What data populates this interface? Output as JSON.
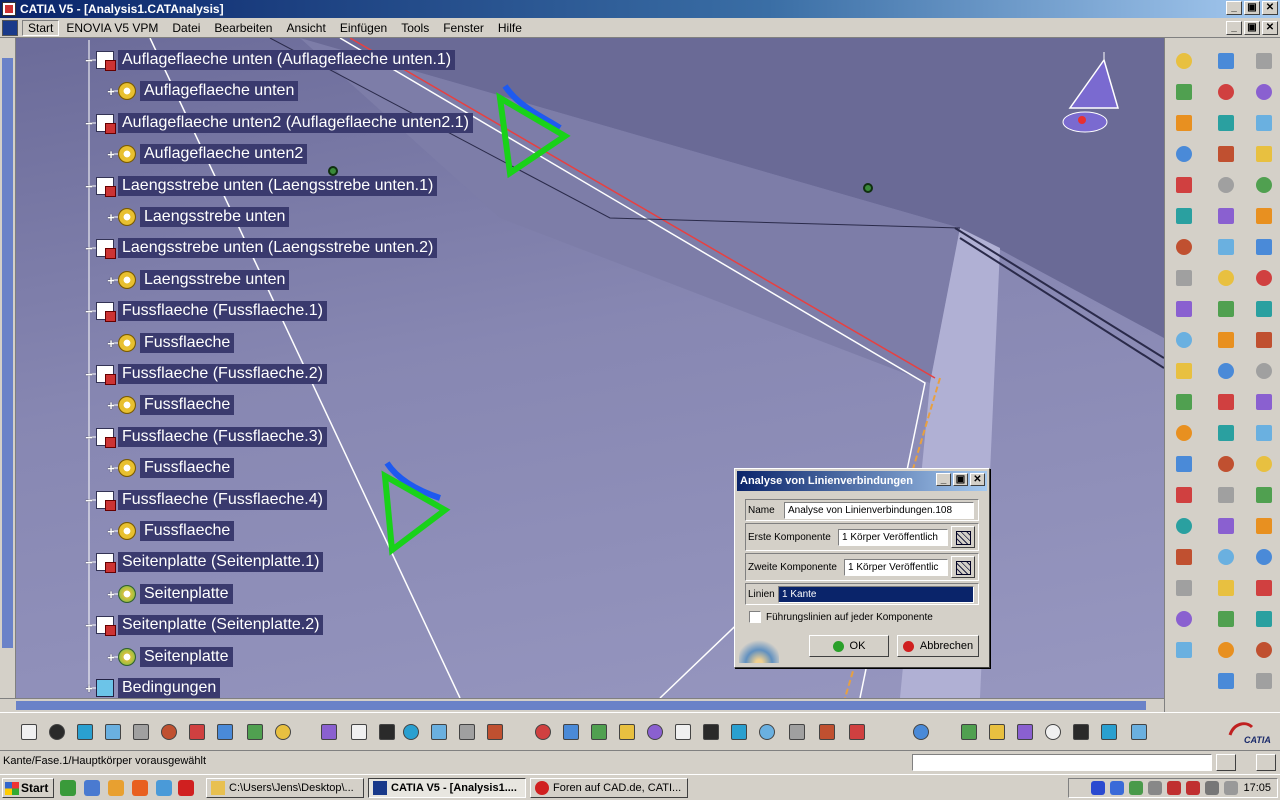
{
  "window": {
    "title": "CATIA V5 - [Analysis1.CATAnalysis]",
    "controls": [
      "_",
      "▣",
      "✕"
    ]
  },
  "menubar": {
    "items": [
      "Start",
      "ENOVIA V5 VPM",
      "Datei",
      "Bearbeiten",
      "Ansicht",
      "Einfügen",
      "Tools",
      "Fenster",
      "Hilfe"
    ]
  },
  "tree": {
    "nodes": [
      {
        "label": "Auflageflaeche unten (Auflageflaeche unten.1)",
        "level": 1,
        "icon": "doc",
        "expander": "−"
      },
      {
        "label": "Auflageflaeche unten",
        "level": 2,
        "icon": "gear",
        "expander": "+"
      },
      {
        "label": "Auflageflaeche unten2 (Auflageflaeche unten2.1)",
        "level": 1,
        "icon": "doc",
        "expander": "−"
      },
      {
        "label": "Auflageflaeche unten2",
        "level": 2,
        "icon": "gear",
        "expander": "+"
      },
      {
        "label": "Laengsstrebe unten (Laengsstrebe unten.1)",
        "level": 1,
        "icon": "doc",
        "expander": "−"
      },
      {
        "label": "Laengsstrebe unten",
        "level": 2,
        "icon": "gear",
        "expander": "+"
      },
      {
        "label": "Laengsstrebe unten (Laengsstrebe unten.2)",
        "level": 1,
        "icon": "doc",
        "expander": "−"
      },
      {
        "label": "Laengsstrebe unten",
        "level": 2,
        "icon": "gear",
        "expander": "+"
      },
      {
        "label": "Fussflaeche (Fussflaeche.1)",
        "level": 1,
        "icon": "doc",
        "expander": "−"
      },
      {
        "label": "Fussflaeche",
        "level": 2,
        "icon": "gear",
        "expander": "+"
      },
      {
        "label": "Fussflaeche (Fussflaeche.2)",
        "level": 1,
        "icon": "doc",
        "expander": "−"
      },
      {
        "label": "Fussflaeche",
        "level": 2,
        "icon": "gear",
        "expander": "+"
      },
      {
        "label": "Fussflaeche (Fussflaeche.3)",
        "level": 1,
        "icon": "doc",
        "expander": "−"
      },
      {
        "label": "Fussflaeche",
        "level": 2,
        "icon": "gear",
        "expander": "+"
      },
      {
        "label": "Fussflaeche (Fussflaeche.4)",
        "level": 1,
        "icon": "doc",
        "expander": "−"
      },
      {
        "label": "Fussflaeche",
        "level": 2,
        "icon": "gear",
        "expander": "+"
      },
      {
        "label": "Seitenplatte (Seitenplatte.1)",
        "level": 1,
        "icon": "doc",
        "expander": "−"
      },
      {
        "label": "Seitenplatte",
        "level": 2,
        "icon": "gear2",
        "expander": "+"
      },
      {
        "label": "Seitenplatte (Seitenplatte.2)",
        "level": 1,
        "icon": "doc",
        "expander": "−"
      },
      {
        "label": "Seitenplatte",
        "level": 2,
        "icon": "gear2",
        "expander": "+"
      },
      {
        "label": "Bedingungen",
        "level": 1,
        "icon": "cond",
        "expander": "+"
      }
    ]
  },
  "dialog": {
    "title": "Analyse von Linienverbindungen",
    "name_label": "Name",
    "name_value": "Analyse von Linienverbindungen.108",
    "first_label": "Erste Komponente",
    "first_value": "1 Körper Veröffentlich",
    "second_label": "Zweite Komponente",
    "second_value": "1 Körper Veröffentlic",
    "lines_label": "Linien",
    "lines_value": "1 Kante",
    "checkbox_label": "Führungslinien auf jeder Komponente",
    "ok_label": "OK",
    "cancel_label": "Abbrechen"
  },
  "statusbar": {
    "message": "Kante/Fase.1/Hauptkörper vorausgewählt"
  },
  "taskbar": {
    "start_label": "Start",
    "tasks": [
      {
        "label": "C:\\Users\\Jens\\Desktop\\...",
        "active": false
      },
      {
        "label": "CATIA V5 - [Analysis1....",
        "active": true
      },
      {
        "label": "Foren auf CAD.de, CATI...",
        "active": false
      }
    ],
    "clock": "17:05"
  },
  "logo": {
    "text": "CATIA"
  },
  "colors": {
    "tree_label_bg": "#3a3a6e",
    "selection": "#0a246a",
    "accent_green": "#19d219",
    "accent_blue": "#1e5af0"
  }
}
